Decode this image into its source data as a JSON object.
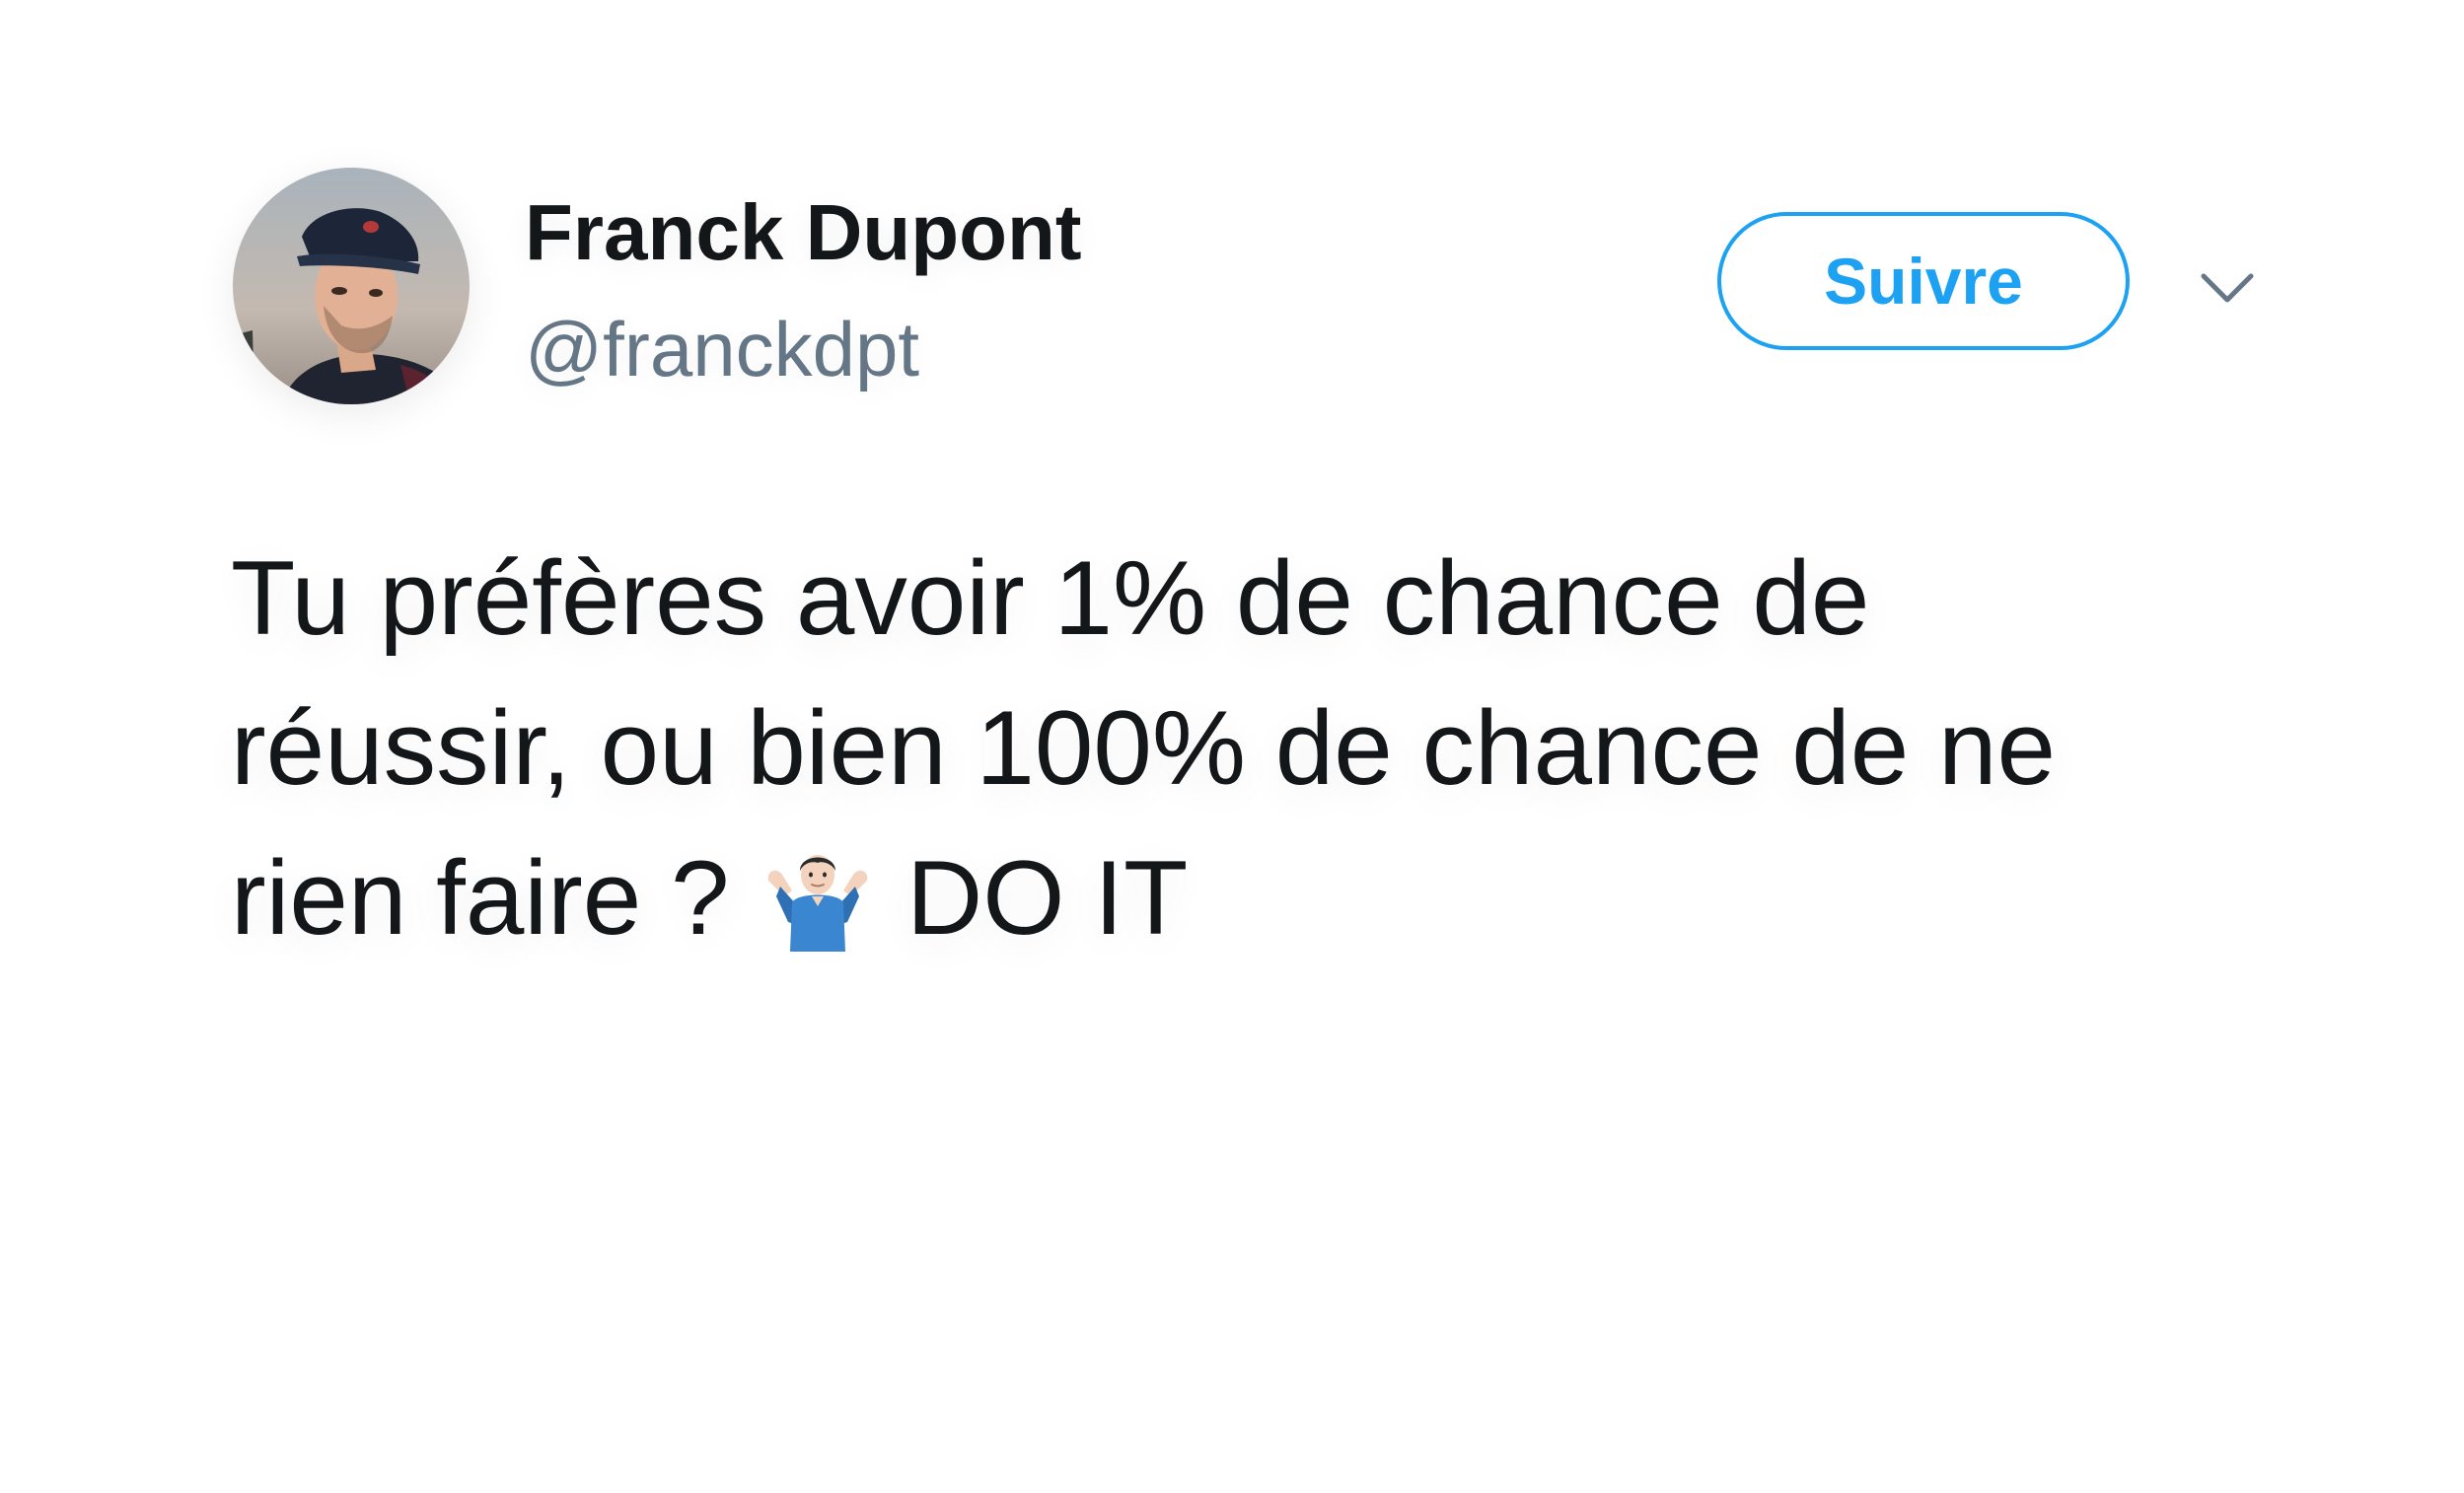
{
  "user": {
    "display_name": "Franck Dupont",
    "handle": "@franckdpt"
  },
  "actions": {
    "follow_label": "Suivre",
    "menu_icon": "chevron-down-icon"
  },
  "tweet": {
    "line1": "Tu préfères avoir 1% de chance de",
    "line2": "réussir, ou bien 100% de chance de ne",
    "line3_before_emoji": "rien faire ? ",
    "emoji": "man-shrugging-emoji",
    "line3_after_emoji": " DO IT"
  },
  "colors": {
    "accent": "#1da1f2",
    "text": "#14171a",
    "secondary_text": "#657786"
  }
}
